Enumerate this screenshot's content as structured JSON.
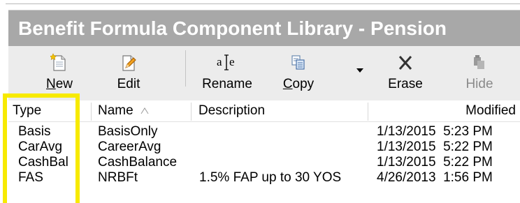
{
  "window": {
    "title": "Benefit Formula Component Library - Pension"
  },
  "toolbar": {
    "buttons": [
      {
        "label": "New",
        "icon": "new-document-icon",
        "enabled": true
      },
      {
        "label": "Edit",
        "icon": "edit-pencil-icon",
        "enabled": true
      },
      {
        "label": "Rename",
        "icon": "rename-text-cursor-icon",
        "enabled": true
      },
      {
        "label": "Copy",
        "icon": "copy-icon",
        "enabled": true
      },
      {
        "label": "Erase",
        "icon": "erase-x-icon",
        "enabled": true
      },
      {
        "label": "Hide",
        "icon": "hide-icon",
        "enabled": false
      }
    ]
  },
  "table": {
    "columns": [
      {
        "label": "Type"
      },
      {
        "label": "Name",
        "sorted": "ascending"
      },
      {
        "label": "Description"
      },
      {
        "label": "Modified"
      }
    ],
    "rows": [
      {
        "type": "Basis",
        "name": "BasisOnly",
        "description": "",
        "modified": "1/13/2015  5:23 PM"
      },
      {
        "type": "CarAvg",
        "name": "CareerAvg",
        "description": "",
        "modified": "1/13/2015  5:22 PM"
      },
      {
        "type": "CashBal",
        "name": "CashBalance",
        "description": "",
        "modified": "1/13/2015  5:22 PM"
      },
      {
        "type": "FAS",
        "name": "NRBFt",
        "description": "1.5% FAP up to 30 YOS",
        "modified": "4/26/2013  1:56 PM"
      }
    ]
  },
  "colors": {
    "highlight": "#f7ea00",
    "titlebar": "#a8a8a8"
  }
}
